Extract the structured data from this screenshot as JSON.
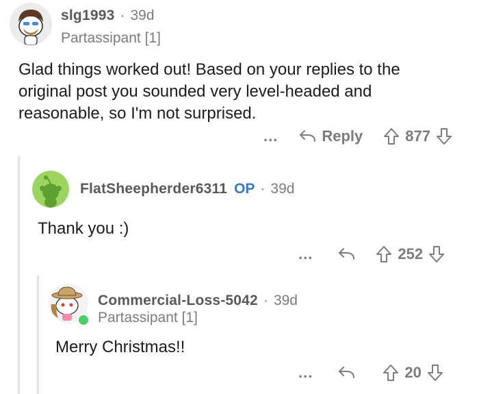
{
  "comments": [
    {
      "username": "slg1993",
      "age": "39d",
      "flair": "Partassipant [1]",
      "body": "Glad things worked out! Based on your replies to the original post you sounded very level-headed and reasonable, so I'm not surprised.",
      "more": "...",
      "reply_label": "Reply",
      "votes": "877",
      "avatar_icon": "bearded-snoo-avatar-icon"
    },
    {
      "username": "FlatSheepherder6311",
      "op_badge": "OP",
      "age": "39d",
      "body": "Thank you :)",
      "more": "...",
      "votes": "252",
      "avatar_icon": "default-snoo-avatar-icon",
      "avatar_bg": "#9bd55f"
    },
    {
      "username": "Commercial-Loss-5042",
      "age": "39d",
      "flair": "Partassipant [1]",
      "body": "Merry Christmas!!",
      "more": "...",
      "votes": "20",
      "avatar_icon": "explorer-snoo-avatar-icon",
      "online_color": "#46d160"
    }
  ],
  "separator": "·",
  "colors": {
    "meta": "#7c7c7c",
    "op": "#3a78c3",
    "thread_line": "#e2e2e2"
  }
}
